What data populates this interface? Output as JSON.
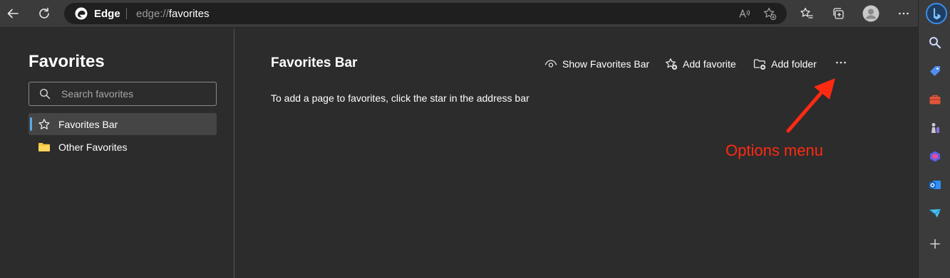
{
  "toolbar": {
    "app_name": "Edge",
    "url_prefix": "edge://",
    "url_path": "favorites"
  },
  "left_pane": {
    "title": "Favorites",
    "search_placeholder": "Search favorites",
    "items": [
      {
        "label": "Favorites Bar",
        "icon": "star-icon",
        "selected": true
      },
      {
        "label": "Other Favorites",
        "icon": "folder-icon",
        "selected": false
      }
    ]
  },
  "main": {
    "title": "Favorites Bar",
    "actions": {
      "show_bar": "Show Favorites Bar",
      "add_favorite": "Add favorite",
      "add_folder": "Add folder"
    },
    "empty_hint": "To add a page to favorites, click the star in the address bar"
  },
  "annotation": {
    "label": "Options menu",
    "color": "#ff2a12"
  },
  "colors": {
    "toolbar_bg": "#3b3b3b",
    "page_bg": "#2c2c2c",
    "address_bg": "#1f1f1f",
    "selection_bar": "#5ea8ea",
    "folder": "#f5c542"
  }
}
